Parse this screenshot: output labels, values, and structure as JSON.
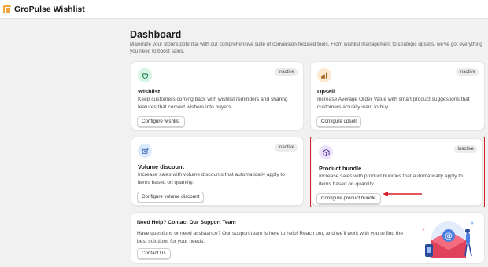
{
  "app": {
    "title": "GroPulse Wishlist"
  },
  "header": {
    "title": "Dashboard",
    "subtitle": "Maximize your store's potential with our comprehensive suite of conversion-focused tools. From wishlist management to strategic upsells, we've got everything you need to boost sales."
  },
  "cards": [
    {
      "title": "Wishlist",
      "status": "Inactive",
      "description": "Keep customers coming back with wishlist reminders and sharing features that convert wishers into buyers.",
      "button": "Configure wishlist",
      "icon": "heart-icon",
      "icon_bg": "#d7f5e3",
      "icon_color": "#1f7a4d"
    },
    {
      "title": "Upsell",
      "status": "Inactive",
      "description": "Increase Average Order Value with smart product suggestions that customers actually want to buy.",
      "button": "Configure upsell",
      "icon": "bar-chart-icon",
      "icon_bg": "#fde9cf",
      "icon_color": "#9a5a10"
    },
    {
      "title": "Volume discount",
      "status": "Inactive",
      "description": "Increase sales with volume discounts that automatically apply to items based on quantity.",
      "button": "Configure volume discount",
      "icon": "archive-box-icon",
      "icon_bg": "#dceafd",
      "icon_color": "#2d5aa8"
    },
    {
      "title": "Product bundle",
      "status": "Inactive",
      "description": "Increase sales with product bundles that automatically apply to items based on quantity.",
      "button": "Configure product bundle",
      "icon": "package-icon",
      "icon_bg": "#ece3fb",
      "icon_color": "#5a3d9a"
    }
  ],
  "support": {
    "title": "Need Help? Contact Our Support Team",
    "description": "Have questions or need assistance? Our support team is here to help! Reach out, and we'll work with you to find the best solutions for your needs.",
    "button": "Contact Us"
  },
  "colors": {
    "accent_highlight": "#d8202a",
    "background": "#f1f1f1",
    "card": "#ffffff"
  }
}
